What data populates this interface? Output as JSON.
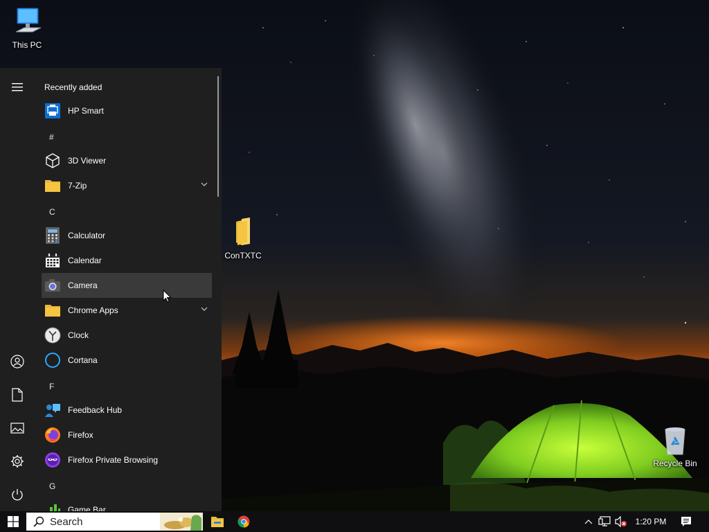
{
  "desktop": {
    "icons": [
      {
        "label": "This PC"
      },
      {
        "label": "ConTXTC"
      },
      {
        "label": "Recycle Bin"
      }
    ]
  },
  "start_menu": {
    "section_header": "Recently added",
    "letters": [
      "#",
      "C",
      "F",
      "G"
    ],
    "apps": [
      {
        "label": "HP Smart",
        "icon": "hp-smart-icon"
      },
      {
        "label": "3D Viewer",
        "icon": "cube-icon"
      },
      {
        "label": "7-Zip",
        "icon": "folder-icon"
      },
      {
        "label": "Calculator",
        "icon": "calculator-icon"
      },
      {
        "label": "Calendar",
        "icon": "calendar-icon"
      },
      {
        "label": "Camera",
        "icon": "camera-icon"
      },
      {
        "label": "Chrome Apps",
        "icon": "folder-icon"
      },
      {
        "label": "Clock",
        "icon": "clock-icon"
      },
      {
        "label": "Cortana",
        "icon": "cortana-icon"
      },
      {
        "label": "Feedback Hub",
        "icon": "feedback-icon"
      },
      {
        "label": "Firefox",
        "icon": "firefox-icon"
      },
      {
        "label": "Firefox Private Browsing",
        "icon": "firefox-private-icon"
      },
      {
        "label": "Game Bar",
        "icon": "game-bar-icon"
      }
    ]
  },
  "taskbar": {
    "search_placeholder": "Search",
    "clock": "1:20 PM"
  },
  "colors": {
    "start_bg": "#1f1f1f",
    "hover_bg": "#3a3a3a",
    "taskbar_bg": "#0f0f12",
    "folder_yellow": "#f5c542",
    "tent_green": "#86d42a"
  }
}
